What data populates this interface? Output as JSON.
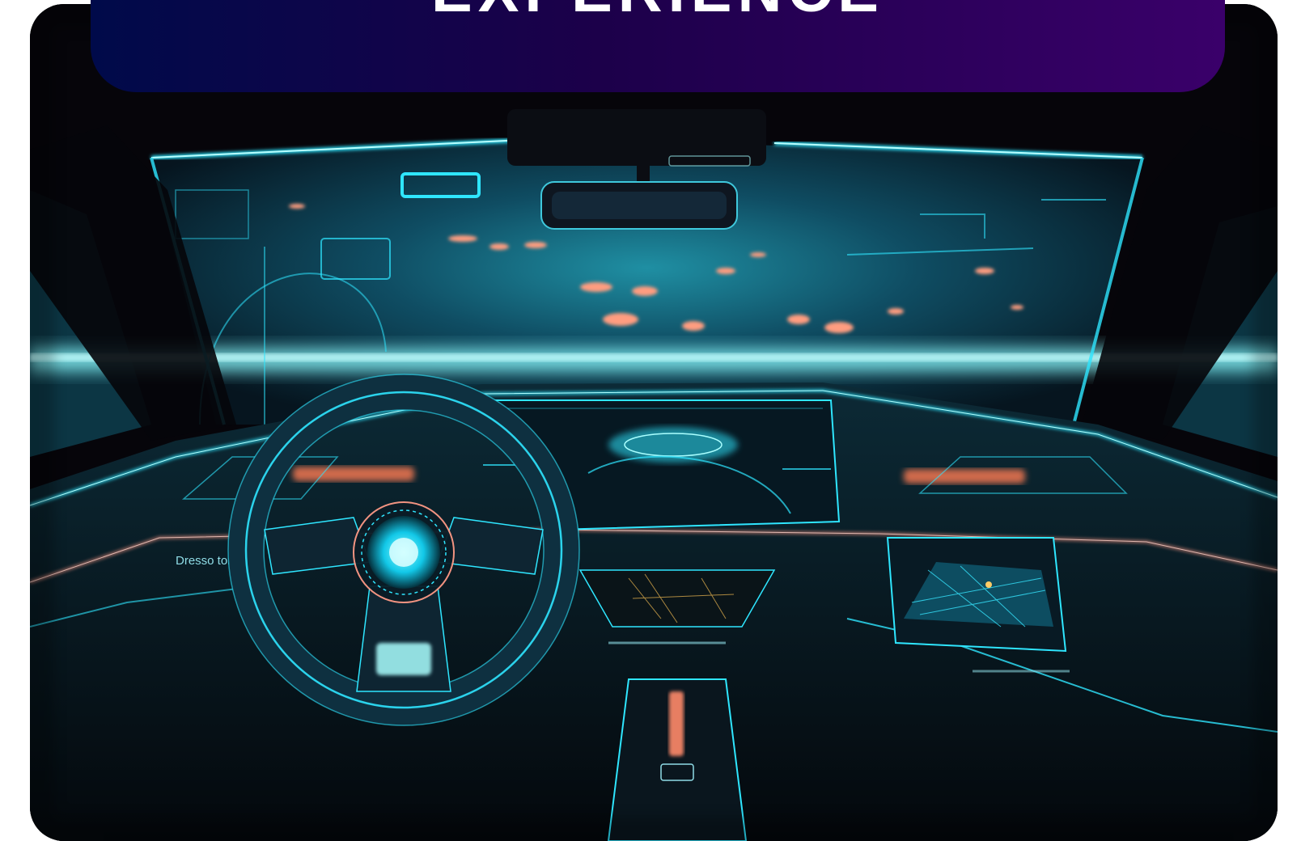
{
  "banner": {
    "title": "EXPERIENCE",
    "gradient_start": "#000a4a",
    "gradient_end": "#3a006a"
  },
  "image": {
    "subject": "futuristic-car-interior",
    "dashboard_label": "Dresso ton",
    "accent_color": "#2fe6ff",
    "glow_color": "#ff8a6a"
  }
}
